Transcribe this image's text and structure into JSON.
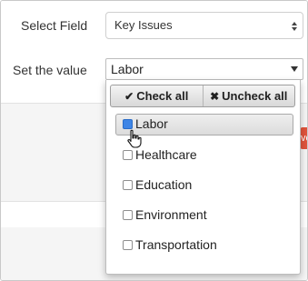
{
  "form": {
    "select_field_label": "Select Field",
    "select_field_value": "Key Issues",
    "set_value_label": "Set the value",
    "set_value_current": "Labor"
  },
  "dropdown": {
    "check_all_label": "Check all",
    "check_all_icon": "checkmark-icon",
    "uncheck_all_label": "Uncheck all",
    "uncheck_all_icon": "x-icon",
    "options": [
      {
        "label": "Labor",
        "checked": true
      },
      {
        "label": "Healthcare",
        "checked": false
      },
      {
        "label": "Education",
        "checked": false
      },
      {
        "label": "Environment",
        "checked": false
      },
      {
        "label": "Transportation",
        "checked": false
      }
    ]
  },
  "background": {
    "partial_tag_text": "ve"
  },
  "colors": {
    "checkbox_checked": "#3e85e6",
    "tag_red": "#e0533b"
  }
}
